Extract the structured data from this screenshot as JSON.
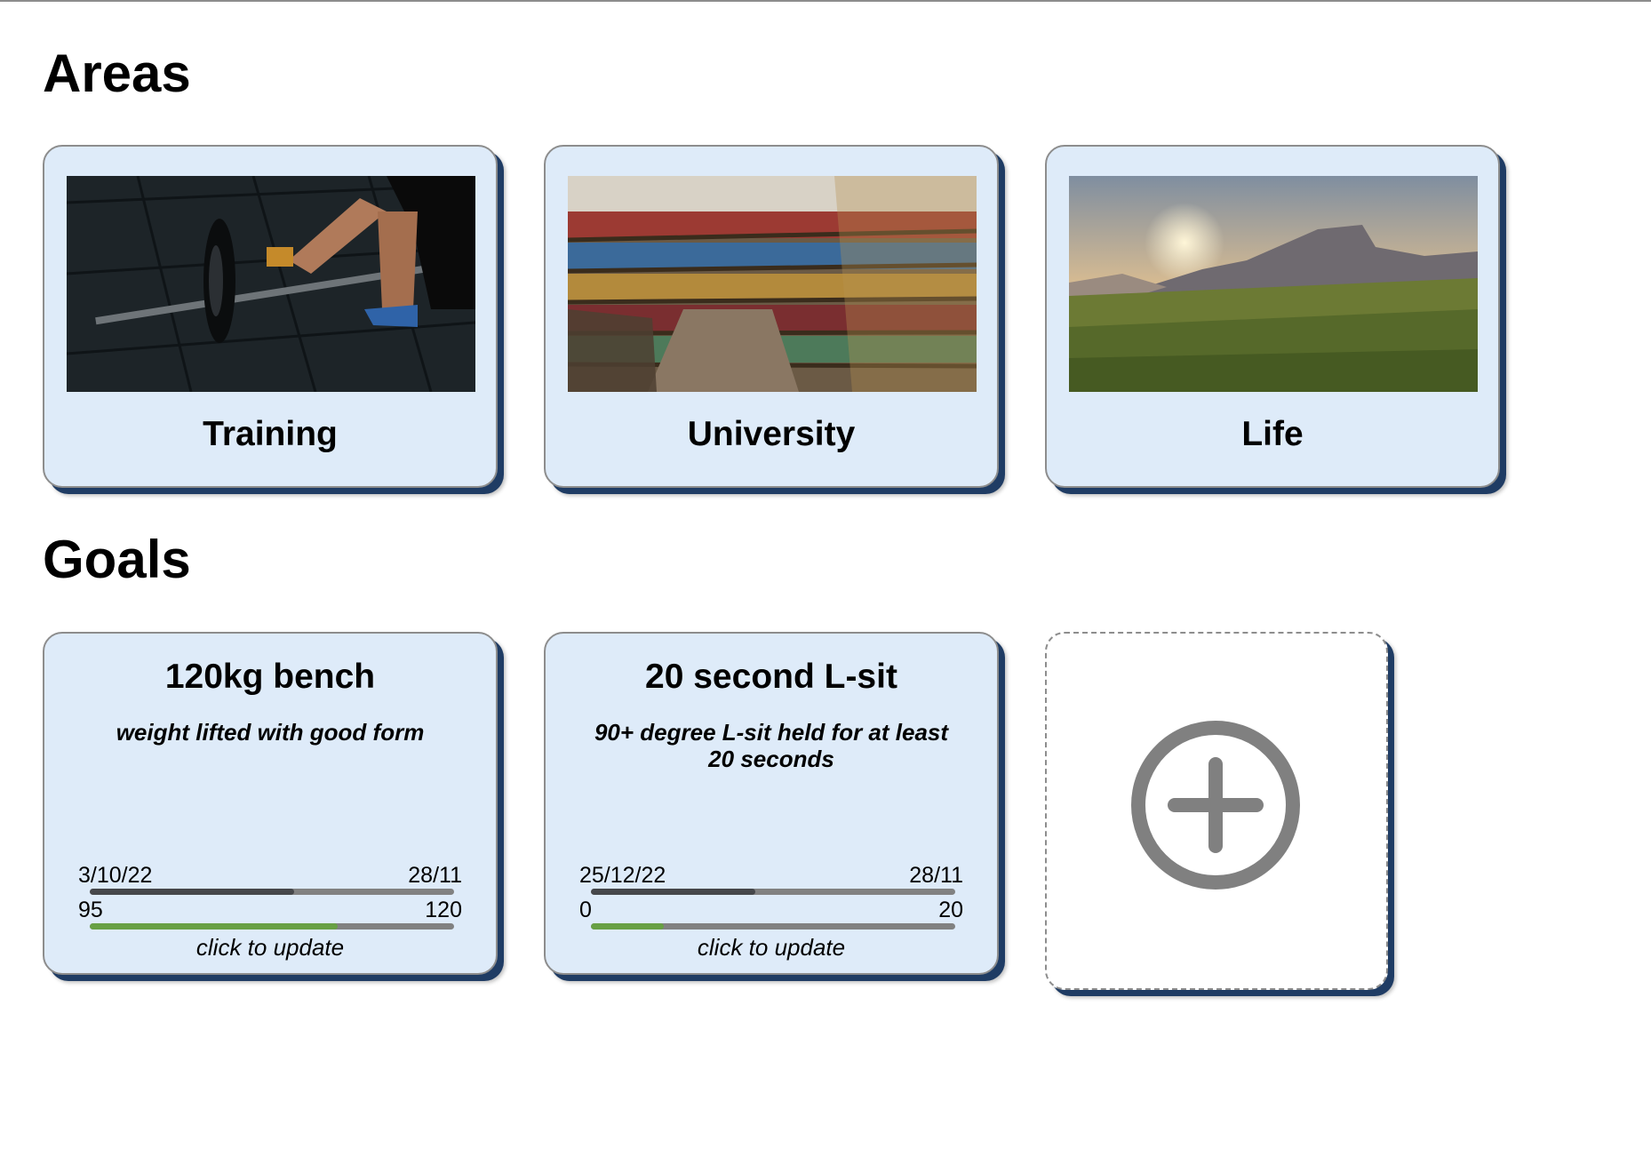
{
  "areas": {
    "heading": "Areas",
    "items": [
      {
        "label": "Training",
        "image": "barbell-deadlift-photo"
      },
      {
        "label": "University",
        "image": "library-bookshelves-photo"
      },
      {
        "label": "Life",
        "image": "mountain-meadow-sunset-photo"
      }
    ]
  },
  "goals": {
    "heading": "Goals",
    "items": [
      {
        "title": "120kg bench",
        "description": "weight lifted with good form",
        "start_date": "3/10/22",
        "end_date": "28/11",
        "time_elapsed_fraction": 0.56,
        "start_value": "95",
        "target_value": "120",
        "progress_fraction": 0.68,
        "hint": "click to update"
      },
      {
        "title": "20 second L-sit",
        "description": "90+ degree L-sit held for at least 20 seconds",
        "start_date": "25/12/22",
        "end_date": "28/11",
        "time_elapsed_fraction": 0.45,
        "start_value": "0",
        "target_value": "20",
        "progress_fraction": 0.2,
        "hint": "click to update"
      }
    ],
    "add_icon": "plus-circle-icon"
  },
  "colors": {
    "card_background": "#deebf9",
    "card_shadow": "#1f3c64",
    "time_bar_fill": "#46474b",
    "progress_bar_fill": "#68a044",
    "bar_track": "#818181",
    "add_icon": "#808080"
  }
}
